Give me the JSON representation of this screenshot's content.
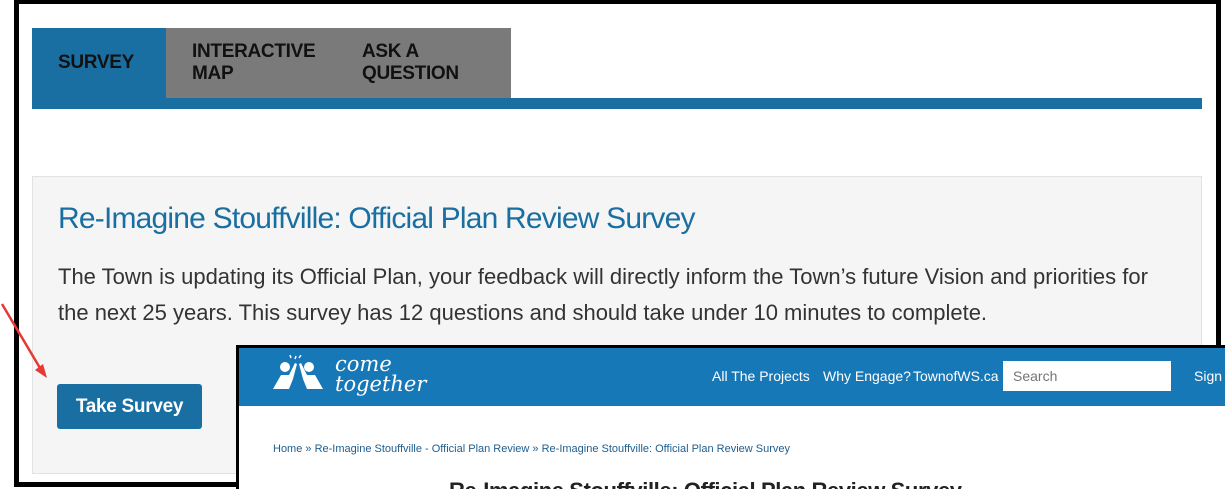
{
  "tabs": [
    {
      "label": "SURVEY"
    },
    {
      "label": "INTERACTIVE MAP"
    },
    {
      "label": "ASK A QUESTION"
    }
  ],
  "survey_card": {
    "title": "Re-Imagine Stouffville: Official Plan Review Survey",
    "description": "The Town is updating its Official Plan, your feedback will directly inform the Town’s future Vision and priorities for the next 25 years.  This survey has 12 questions and should take under 10 minutes to complete.",
    "button_label": "Take Survey"
  },
  "overlay": {
    "logo_line1": "come",
    "logo_line2": "together",
    "nav": [
      "All The Projects",
      "Why Engage?",
      "TownofWS.ca"
    ],
    "search_placeholder": "Search",
    "signin": "Sign",
    "breadcrumb": "Home » Re-Imagine Stouffville - Official Plan Review » Re-Imagine Stouffville: Official Plan Review Survey",
    "page_title": "Re-Imagine Stouffville: Official Plan Review Survey"
  },
  "colors": {
    "primary": "#196fa1",
    "tab_inactive": "#7a7a7a",
    "topbar": "#1778b8",
    "arrow": "#e53935"
  }
}
